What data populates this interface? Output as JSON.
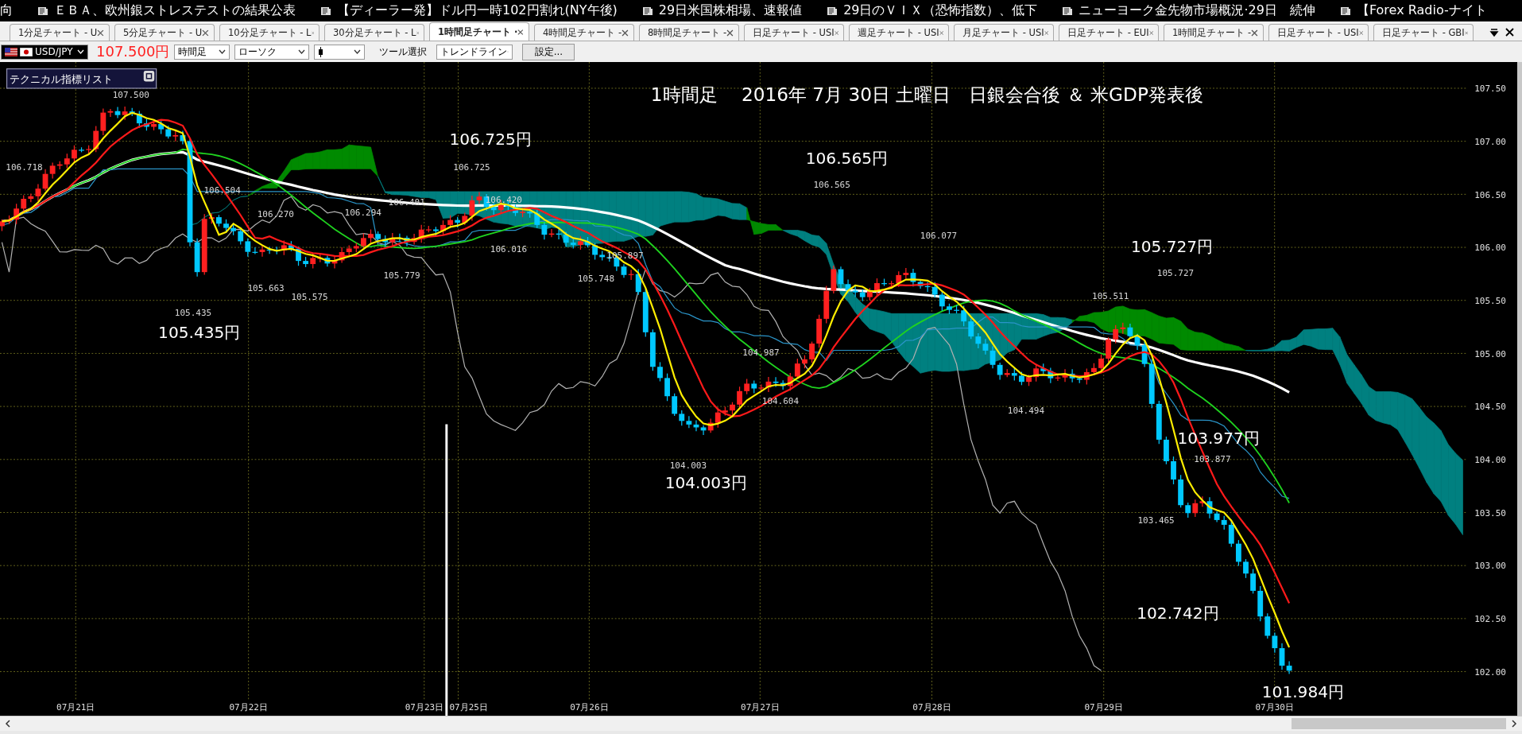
{
  "news_ticker": [
    {
      "text": "向",
      "icon": false
    },
    {
      "text": "ＥＢＡ、欧州銀ストレステストの結果公表",
      "icon": true
    },
    {
      "text": "【ディーラー発】ドル円一時102円割れ(NY午後)",
      "icon": true
    },
    {
      "text": "29日米国株相場、速報値",
      "icon": true
    },
    {
      "text": "29日のＶＩＸ（恐怖指数）、低下",
      "icon": true
    },
    {
      "text": "ニューヨーク金先物市場概況·29日　続伸",
      "icon": true
    },
    {
      "text": "【Forex Radio-ナイト",
      "icon": true
    }
  ],
  "tabs": [
    {
      "label": "1分足チャート - U",
      "selected": false
    },
    {
      "label": "5分足チャート - U",
      "selected": false
    },
    {
      "label": "10分足チャート - L",
      "selected": false
    },
    {
      "label": "30分足チャート - L",
      "selected": false
    },
    {
      "label": "1時間足チャート ·",
      "selected": true
    },
    {
      "label": "4時間足チャート -",
      "selected": false
    },
    {
      "label": "8時間足チャート -",
      "selected": false
    },
    {
      "label": "日足チャート - USI",
      "selected": false
    },
    {
      "label": "週足チャート - USI",
      "selected": false
    },
    {
      "label": "月足チャート - USI",
      "selected": false
    },
    {
      "label": "日足チャート - EUI",
      "selected": false
    },
    {
      "label": "1時間足チャート -",
      "selected": false
    },
    {
      "label": "日足チャート - USI",
      "selected": false
    },
    {
      "label": "日足チャート - GBI",
      "selected": false
    }
  ],
  "toolbar": {
    "symbol": "USD/JPY",
    "timeframe": "時間足",
    "chart_type": "ローソク",
    "tool_label": "ツール選択",
    "tool": "トレンドライン",
    "settings_button": "設定..."
  },
  "price_marker": "107.500円",
  "chart": {
    "title": "1時間足　 2016年 7月 30日 土曜日　日銀会合後 ＆ 米GDP発表後",
    "indicator_panel": "テクニカル指標リスト",
    "annotations": [
      "106.725円",
      "105.435円",
      "106.565円",
      "104.003円",
      "105.727円",
      "103.977円",
      "102.742円",
      "101.984円"
    ],
    "point_labels": [
      "107.500",
      "106.718",
      "106.504",
      "106.270",
      "106.294",
      "106.401",
      "106.725",
      "106.420",
      "106.016",
      "105.779",
      "105.663",
      "105.575",
      "105.435",
      "105.897",
      "105.748",
      "106.565",
      "106.077",
      "104.987",
      "104.604",
      "104.003",
      "104.494",
      "105.511",
      "105.727",
      "103.877",
      "103.465"
    ],
    "y_axis": [
      "107.50",
      "107.00",
      "106.50",
      "106.00",
      "105.50",
      "105.00",
      "104.50",
      "104.00",
      "103.50",
      "103.00",
      "102.50",
      "102.00"
    ],
    "x_axis": [
      "07月21日",
      "07月22日",
      "07月23日",
      "07月25日",
      "07月26日",
      "07月27日",
      "07月28日",
      "07月29日",
      "07月30日"
    ]
  }
}
